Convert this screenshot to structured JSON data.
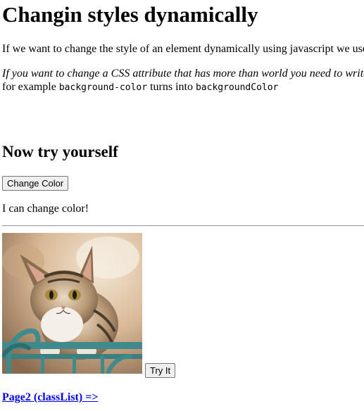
{
  "title": "Changin styles dynamically",
  "intro": "If we want to change the style of an element dynamically using javascript we use",
  "tip_italic": "If you want to change a CSS attribute that has more than world you need to write",
  "tip_for_example": "for example",
  "tip_code_from": "background-color",
  "tip_turns_into": "turns into",
  "tip_code_to": "backgroundColor",
  "subtitle": "Now try yourself",
  "change_color_button": "Change Color",
  "change_text": "I can change color!",
  "try_it_button": "Try It",
  "next_link": "Page2 (classList) =>"
}
